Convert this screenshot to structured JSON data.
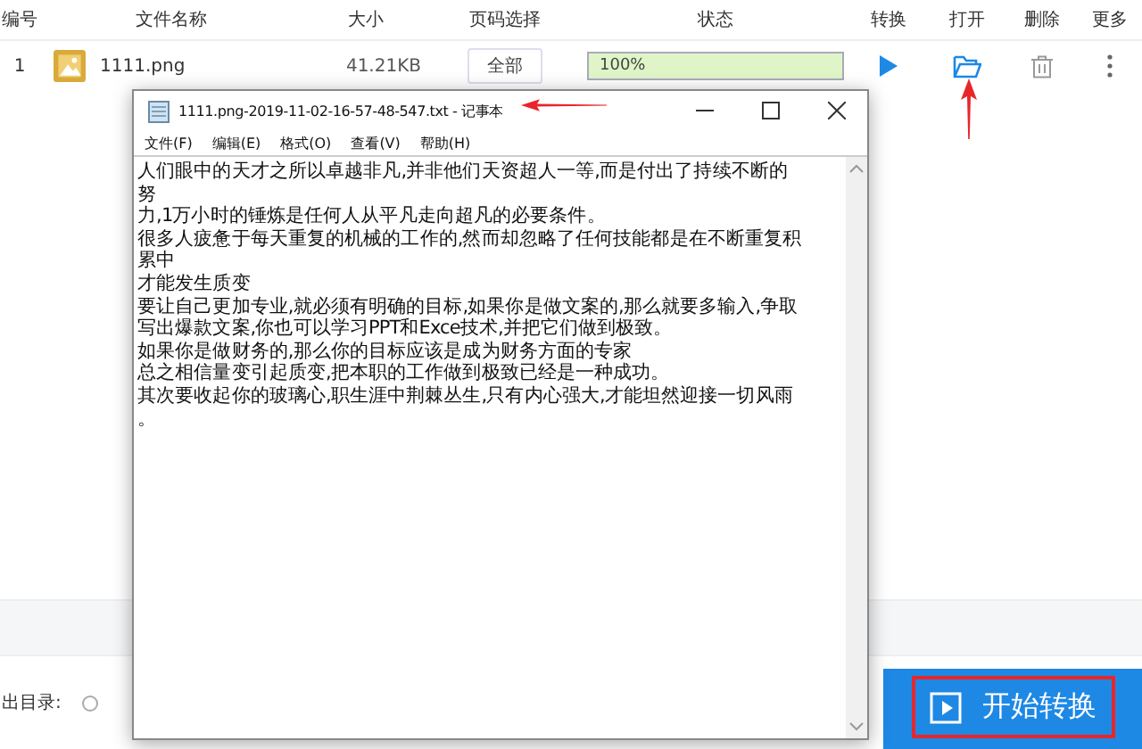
{
  "table": {
    "columns": [
      "编号",
      "文件名称",
      "大小",
      "页码选择",
      "状态",
      "转换",
      "打开",
      "删除",
      "更多"
    ],
    "rows": [
      {
        "number": "1",
        "file_name": "1111.png",
        "size": "41.21KB",
        "page_select": "全部",
        "status_text": "100%",
        "level": 1.0
      }
    ]
  },
  "output": {
    "label": "出目录:",
    "selected": false
  },
  "start_button": "开始转换",
  "notepad": {
    "title": "1111.png-2019-11-02-16-57-48-547.txt - 记事本",
    "menu": [
      "文件(F)",
      "编辑(E)",
      "格式(O)",
      "查看(V)",
      "帮助(H)"
    ],
    "lines": [
      "人们眼中的天才之所以卓越非凡,并非他们天资超人一等,而是付出了持续不断的",
      "努",
      "力,1万小时的锤炼是任何人从平凡走向超凡的必要条件。",
      "很多人疲惫于每天重复的机械的工作的,然而却忽略了任何技能都是在不断重复积",
      "累中",
      "才能发生质变",
      "要让自己更加专业,就必须有明确的目标,如果你是做文案的,那么就要多输入,争取",
      "写出爆款文案,你也可以学习PPT和Exce技术,并把它们做到极致。",
      "如果你是做财务的,那么你的目标应该是成为财务方面的专家",
      "总之相信量变引起质变,把本职的工作做到极致已经是一种成功。",
      "其次要收起你的玻璃心,职生涯中荆棘丛生,只有内心强大,才能坦然迎接一切风雨",
      "。"
    ]
  }
}
